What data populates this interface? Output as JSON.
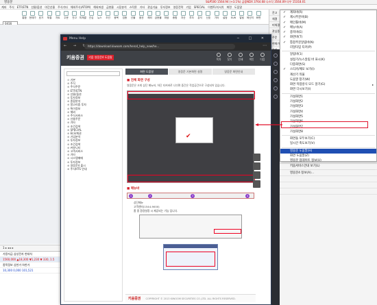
{
  "app": {
    "title": "영웅문",
    "ticker": "S&P500 1564.94 (+3.1%)  금융NDX 3764.68  나스닥 3564.09  다우 15318.01",
    "menus": [
      "계좌",
      "주식",
      "ETF/ETN",
      "선물/옵션",
      "야간선물",
      "주식기타",
      "해외주식(ATOM)",
      "해외파생",
      "금현물",
      "시장분석",
      "스탁론",
      "기타",
      "관심기술",
      "투자정보",
      "영웅전략",
      "기업",
      "SPECIAL",
      "이벤트/리서치",
      "화면",
      "도움말"
    ],
    "toolbar_input": "0416",
    "toolbar_buttons": [
      "통합",
      "현재가",
      "호가",
      "체결",
      "차트",
      "주문",
      "잔고",
      "미체결",
      "관심",
      "뉴스",
      "조건",
      "종목",
      "업종",
      "선물",
      "옵션",
      "해외",
      "금현물",
      "파생",
      "종합",
      "자산",
      "투자",
      "분석",
      "신호",
      "기타",
      "설정",
      "ELW",
      "알림",
      "메신저",
      "화면"
    ]
  },
  "right_panel": {
    "rows": [
      "잔고",
      "체결",
      "미체결",
      "관심종목",
      "주문",
      "현재가",
      "호가",
      "차트",
      "뉴스",
      "공시",
      "투자자",
      "기관",
      "외국인",
      "업종",
      "선물",
      "옵션",
      "ETF",
      "ELW",
      "해외",
      "금현물",
      "환율",
      "지수",
      "조건",
      "신호",
      "알림",
      "설정",
      "기타",
      "메뉴",
      "검색",
      "도움말"
    ]
  },
  "status": {
    "left": "1 ▸ ◂ ▸ ▸",
    "right": "정상"
  },
  "bottom_panel": {
    "rows": [
      "가용자금    삼성전자    현대차",
      "1560,000 ▲18,300 ▼1,230   ▼ 330, 1.5",
      "종목정보    상한가    하한가",
      "10,300    0,000    101,521"
    ]
  },
  "browser": {
    "title": "Menu Help",
    "url": "https://download.kiwoom.com/hero4_help_new/he...",
    "help_brand": "키움증권",
    "help_tag": "키움 영웅문4 도움말",
    "header_icons": [
      "목차",
      "찾기",
      "인쇄",
      "색인",
      "다음"
    ],
    "tree_items": [
      "기본",
      "주식",
      "주식주문",
      "ETF/ETN",
      "선물/옵션",
      "투자정보",
      "종합분석",
      "알고리즘 투자",
      "특이정보",
      "해외",
      "주식서비스",
      "선물주문",
      "기타",
      "조건검색",
      "SPECIAL",
      "ELS/채권",
      "기업분석",
      "투자정보",
      "조건검색",
      "커뮤니티",
      "고객서비스",
      "기타",
      "시스템매매",
      "투자정보",
      "영웅문4 출시",
      "주식HTS 안내"
    ],
    "tabs": [
      "화면 도움말",
      "영웅문 기본화면 설명",
      "영웅문 화면안내"
    ],
    "section1_title": "전체 화면 구성",
    "section1_desc": "영웅문은 크게 상단 메뉴바, 하단 티커바로 나뉘며 중간은 작업공간으로 구성되어 있습니다.",
    "section2_title": "메뉴바",
    "sub_items": [
      "상단메뉴",
      "고객센터(1544-9000)",
      "홈 중 환경설정 시 제공되는 기능 입니다."
    ],
    "footer_brand": "키움증권",
    "footer_copy": "COPYRIGHT © 2013 KIWOOM SECURITIES CO.,LTD. ALL RIGHTS RESERVED."
  },
  "context_menu": {
    "items": [
      {
        "label": "계좌바(R)",
        "checked": true
      },
      {
        "label": "제시주문바(B)",
        "checked": true
      },
      {
        "label": "메인툴바(M)",
        "checked": true
      },
      {
        "label": "메뉴바(A)",
        "checked": true
      },
      {
        "label": "종목바(E)",
        "checked": true
      },
      {
        "label": "화면바(T)",
        "checked": true
      },
      {
        "label": "통합주문알림바(N)",
        "checked": true
      },
      {
        "label": "리얼타임 티커(P)",
        "checked": false
      },
      {
        "sep": true
      },
      {
        "label": "알림바(1)",
        "checked": false
      },
      {
        "label": "설정기/뉴스알림 바 표시(K)",
        "checked": false
      },
      {
        "label": "다중화면(S)",
        "checked": false
      },
      {
        "label": "스티커/메모 보기(I)",
        "checked": true
      },
      {
        "label": "계산기 띄울",
        "checked": false
      },
      {
        "label": "도움말 창기(W)",
        "checked": false
      },
      {
        "label": "화면 작업방식 모드 알기(G)",
        "checked": false,
        "arrow": true
      },
      {
        "label": "화면 다시보기(I)",
        "checked": false
      },
      {
        "sep": true
      },
      {
        "label": "가설화면1",
        "checked": false
      },
      {
        "label": "가설화면2",
        "checked": false
      },
      {
        "label": "가설화면3",
        "checked": false
      },
      {
        "label": "가설화면4",
        "checked": false
      },
      {
        "label": "가설화면5",
        "checked": false
      },
      {
        "label": "가설화면6",
        "checked": false
      },
      {
        "label": "가설화면7",
        "checked": false
      },
      {
        "label": "가설화면8",
        "checked": false
      },
      {
        "sep": true
      },
      {
        "label": "화면들 모두보기(C)",
        "checked": false
      },
      {
        "label": "일시간 축도보기(V)",
        "checked": false
      },
      {
        "sep": true
      },
      {
        "label": "영웅문 도움말(H)",
        "checked": false,
        "highlight": true
      },
      {
        "label": "화면 도움말(Z)",
        "checked": false
      },
      {
        "label": "영웅문 업데이트 정보(U)",
        "checked": false
      },
      {
        "label": "키움서비스안내 보기(L)",
        "checked": false
      },
      {
        "sep": true
      },
      {
        "label": "영웅문4 정보(A)...",
        "checked": false
      }
    ]
  },
  "colors": {
    "highlight": "#1f4fb3",
    "annotation_red": "#e0102a",
    "brand_red": "#d9212c",
    "browser_chrome": "#1f2937"
  }
}
